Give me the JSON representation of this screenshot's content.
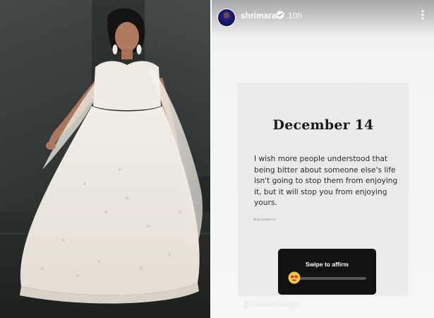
{
  "story": {
    "username": "shrimarai",
    "timestamp": "10h"
  },
  "quote_card": {
    "date": "December 14",
    "quote": "I wish more people understood that being bitter about someone else's life isn't going to stop them from enjoying it, but it will stop you from enjoying yours.",
    "author": "Nina Grewal / X"
  },
  "sticker": {
    "label": "Swipe to affirm",
    "emoji": "heart-eyes-emoji"
  },
  "mention": "@thelovechange",
  "icons": {
    "verified": "verified-badge-icon",
    "more": "more-options-icon"
  },
  "colors": {
    "sticker_bg": "#111111",
    "card_bg": "#eaeaea",
    "verified_blue": "#ffffff"
  }
}
